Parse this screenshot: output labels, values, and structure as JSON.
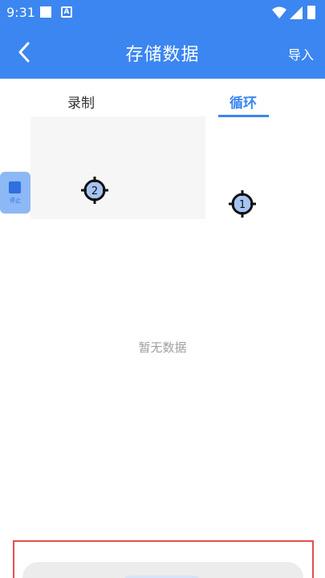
{
  "status_bar": {
    "time": "9:31",
    "icons": [
      "notification-square-icon",
      "app-a-icon",
      "wifi-icon",
      "signal-icon",
      "battery-icon"
    ]
  },
  "header": {
    "title": "存储数据",
    "import_label": "导入",
    "back_icon": "chevron-left-icon",
    "background_color": "#3b86f0"
  },
  "tabs": [
    {
      "label": "录制",
      "active": false
    },
    {
      "label": "循环",
      "active": true
    }
  ],
  "floating_button": {
    "label": "停止",
    "icon": "stop-square-icon"
  },
  "targets": [
    {
      "label": "2"
    },
    {
      "label": "1"
    }
  ],
  "empty_state": {
    "text": "暂无数据"
  },
  "colors": {
    "accent": "#3b86f0",
    "highlight_border": "#e05050"
  }
}
